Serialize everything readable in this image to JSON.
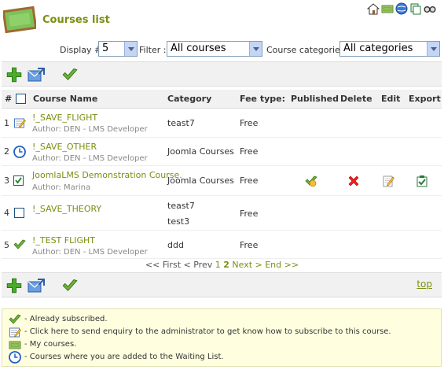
{
  "header": {
    "title": "Courses list",
    "board_icon": "blackboard-icon",
    "top_icons": [
      "home-icon",
      "money-icon",
      "globe-icon",
      "copy-icon",
      "glasses-icon"
    ]
  },
  "filters": {
    "display_label": "Display #",
    "display_value": "5",
    "filter_label": "Filter :",
    "filter_value": "All courses",
    "categories_label": "Course categories:",
    "categories_value": "All categories"
  },
  "toolbar": {
    "add_icon": "add-icon",
    "send_icon": "send-icon",
    "subscribe_icon": "check-icon",
    "top_link": "top"
  },
  "table": {
    "headers": {
      "hash": "#",
      "course_name": "Course Name",
      "category": "Category",
      "fee_type": "Fee type:",
      "published": "Published",
      "delete": "Delete",
      "edit": "Edit",
      "export": "Export"
    },
    "rows": [
      {
        "num": "1",
        "status_icon": "enquiry-icon",
        "name": "!_SAVE_FLIGHT",
        "author": "Author: DEN - LMS Developer",
        "category": "teast7",
        "category2": "",
        "fee": "Free"
      },
      {
        "num": "2",
        "status_icon": "clock-icon",
        "name": "!_SAVE_OTHER",
        "author": "Author: DEN - LMS Developer",
        "category": "Joomla Courses",
        "category2": "",
        "fee": "Free"
      },
      {
        "num": "3",
        "status_icon": "checkbox-checked",
        "name": "JoomlaLMS Demonstration Course.",
        "author": "Author: Marina",
        "category": "Joomla Courses",
        "category2": "",
        "fee": "Free"
      },
      {
        "num": "4",
        "status_icon": "checkbox-empty",
        "name": "!_SAVE_THEORY",
        "author": "",
        "category": "teast7",
        "category2": "test3",
        "fee": "Free"
      },
      {
        "num": "5",
        "status_icon": "check-icon",
        "name": "!_TEST FLIGHT",
        "author": "Author: DEN - LMS Developer",
        "category": "ddd",
        "category2": "",
        "fee": "Free"
      }
    ]
  },
  "pager": {
    "first": "<< First",
    "prev": "< Prev",
    "page1": "1",
    "page2": "2",
    "next": "Next >",
    "end": "End >>"
  },
  "legend": {
    "items": [
      {
        "icon": "check-icon",
        "text": "- Already subscribed."
      },
      {
        "icon": "enquiry-icon",
        "text": "- Click here to send enquiry to the administrator to get know how to subscribe to this course."
      },
      {
        "icon": "money-icon",
        "text": "- My courses."
      },
      {
        "icon": "clock-icon",
        "text": "- Courses where you are added to the Waiting List."
      }
    ]
  }
}
